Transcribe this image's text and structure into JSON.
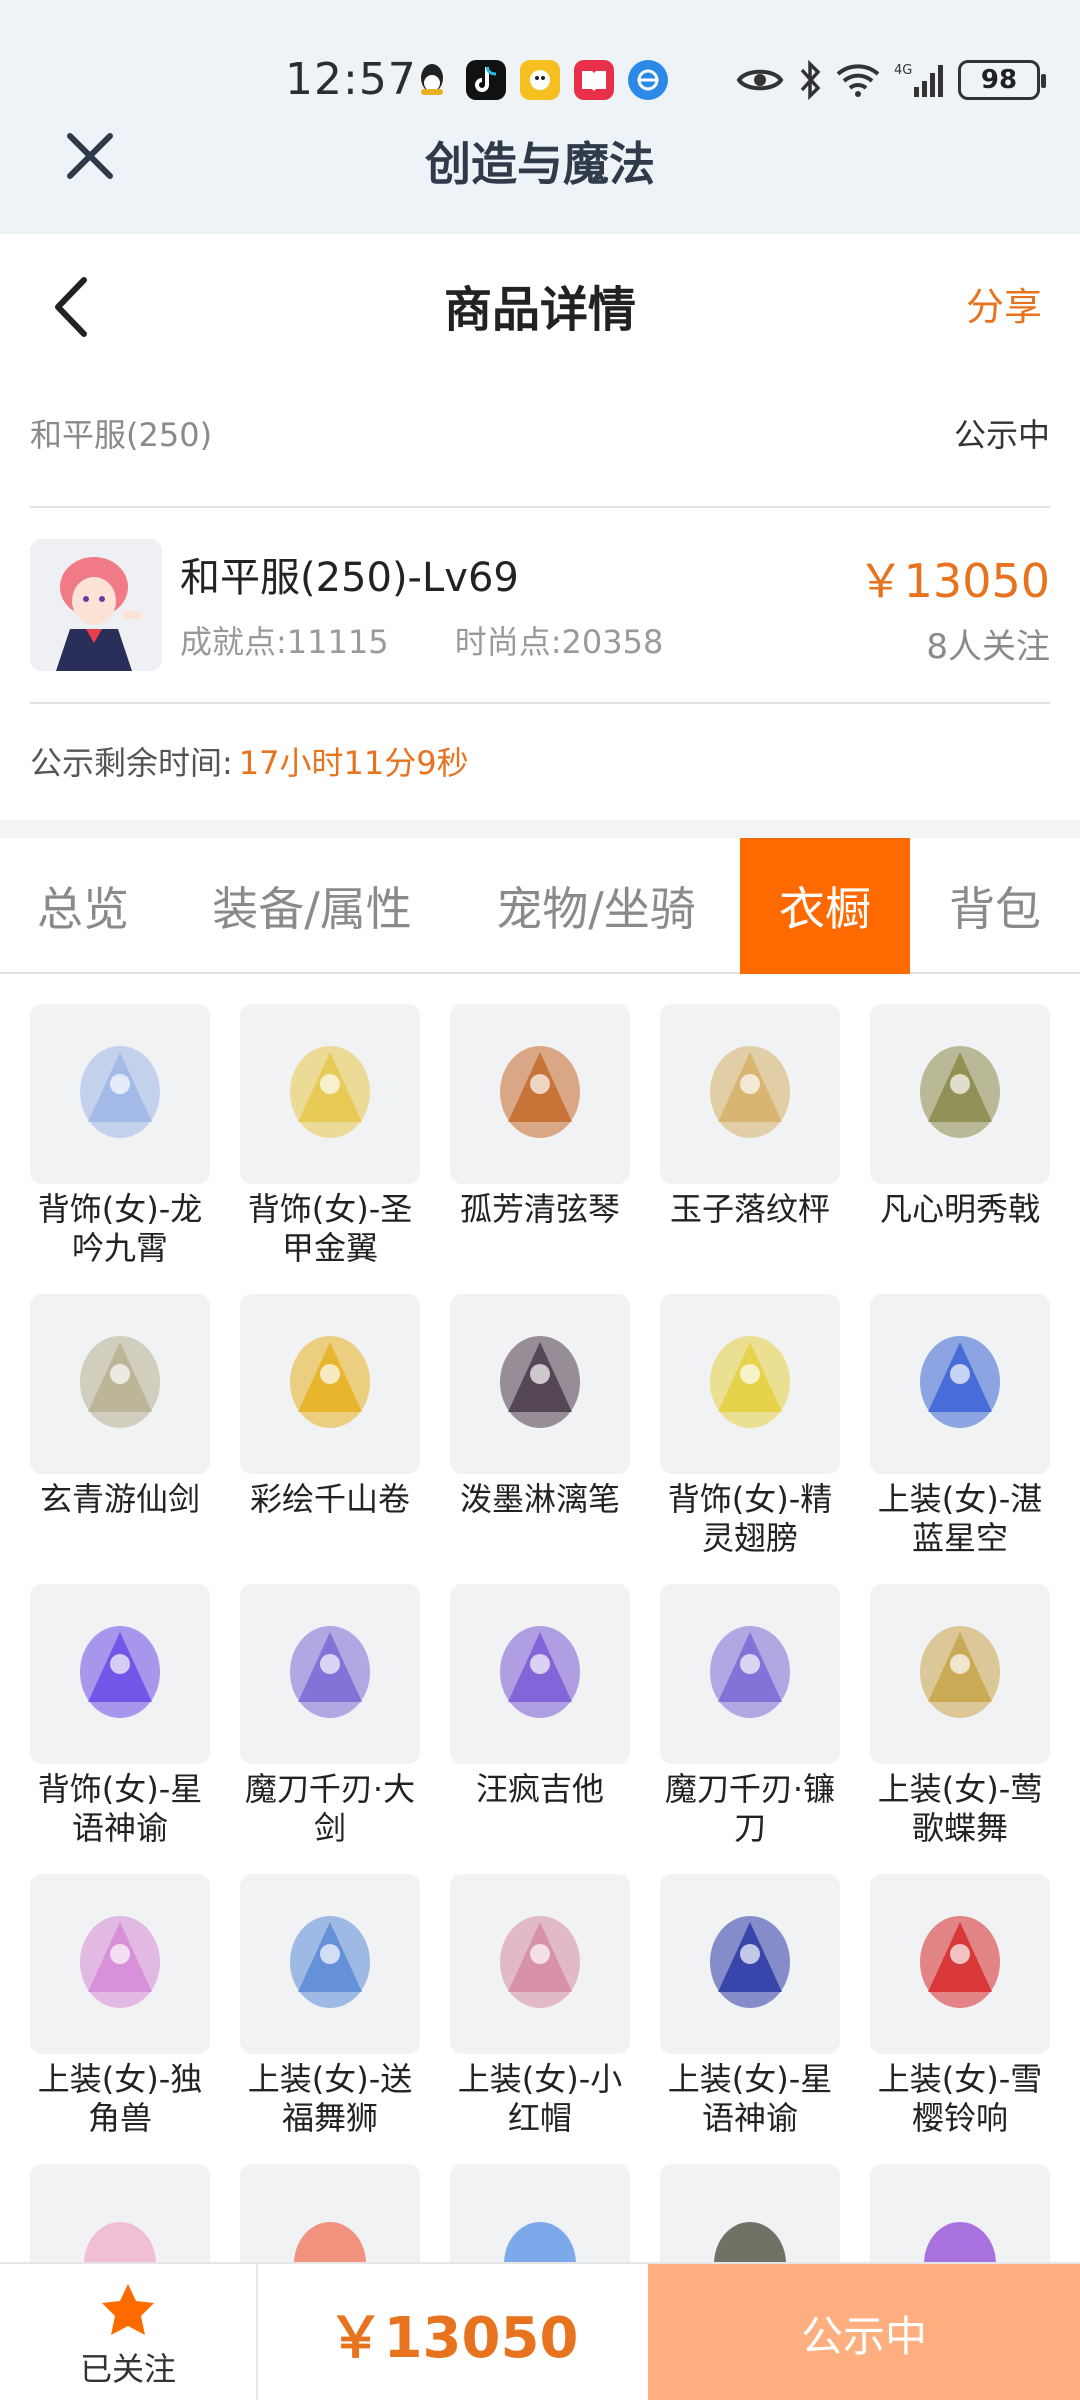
{
  "status_bar": {
    "time": "12:57",
    "battery": "98"
  },
  "app": {
    "title": "创造与魔法"
  },
  "page": {
    "title": "商品详情",
    "share_label": "分享"
  },
  "meta": {
    "server": "和平服(250)",
    "status": "公示中"
  },
  "item": {
    "name": "和平服(250)-Lv69",
    "achievement": "成就点:11115",
    "fashion": "时尚点:20358",
    "price": "￥13050",
    "follows": "8人关注"
  },
  "remaining": {
    "label": "公示剩余时间:",
    "value": "17小时11分9秒"
  },
  "tabs": [
    "总览",
    "装备/属性",
    "宠物/坐骑",
    "衣橱",
    "背包"
  ],
  "active_tab": "衣橱",
  "wardrobe": [
    {
      "name": "背饰(女)-龙吟九霄",
      "icon": "dragon-icon",
      "color": "#9fb6e6"
    },
    {
      "name": "背饰(女)-圣甲金翼",
      "icon": "wings-icon",
      "color": "#e6c84a"
    },
    {
      "name": "孤芳清弦琴",
      "icon": "instrument-icon",
      "color": "#c46a2a"
    },
    {
      "name": "玉子落纹枰",
      "icon": "board-icon",
      "color": "#d6b066"
    },
    {
      "name": "凡心明秀戟",
      "icon": "halberd-icon",
      "color": "#8a8a4a"
    },
    {
      "name": "玄青游仙剑",
      "icon": "swords-icon",
      "color": "#b8b090"
    },
    {
      "name": "彩绘千山卷",
      "icon": "scroll-icon",
      "color": "#e6b020"
    },
    {
      "name": "泼墨淋漓笔",
      "icon": "brush-icon",
      "color": "#4a3a4a"
    },
    {
      "name": "背饰(女)-精灵翅膀",
      "icon": "butterfly-icon",
      "color": "#e6d040"
    },
    {
      "name": "上装(女)-湛蓝星空",
      "icon": "dress-icon",
      "color": "#3a64d6"
    },
    {
      "name": "背饰(女)-星语神谕",
      "icon": "orbs-icon",
      "color": "#6a4ae6"
    },
    {
      "name": "魔刀千刃·大剑",
      "icon": "greatsword-icon",
      "color": "#7a6ad6"
    },
    {
      "name": "汪疯吉他",
      "icon": "guitar-icon",
      "color": "#7a5ad6"
    },
    {
      "name": "魔刀千刃·镰刀",
      "icon": "scythe-icon",
      "color": "#7a6ad6"
    },
    {
      "name": "上装(女)-莺歌蝶舞",
      "icon": "robe-icon",
      "color": "#c8a44a"
    },
    {
      "name": "上装(女)-独角兽",
      "icon": "unicorn-icon",
      "color": "#d68ad6"
    },
    {
      "name": "上装(女)-送福舞狮",
      "icon": "lion-costume-icon",
      "color": "#5a8ad6"
    },
    {
      "name": "上装(女)-小红帽",
      "icon": "dress-icon",
      "color": "#d68aa4"
    },
    {
      "name": "上装(女)-星语神谕",
      "icon": "robe-icon",
      "color": "#2a3aa6"
    },
    {
      "name": "上装(女)-雪樱铃响",
      "icon": "kimono-icon",
      "color": "#d62a2a"
    }
  ],
  "bottom_bar": {
    "follow_label": "已关注",
    "price": "￥13050",
    "status": "公示中"
  },
  "colors": {
    "accent": "#e8731e",
    "tab_active": "#ff6a00",
    "status_button": "#ffae80"
  }
}
